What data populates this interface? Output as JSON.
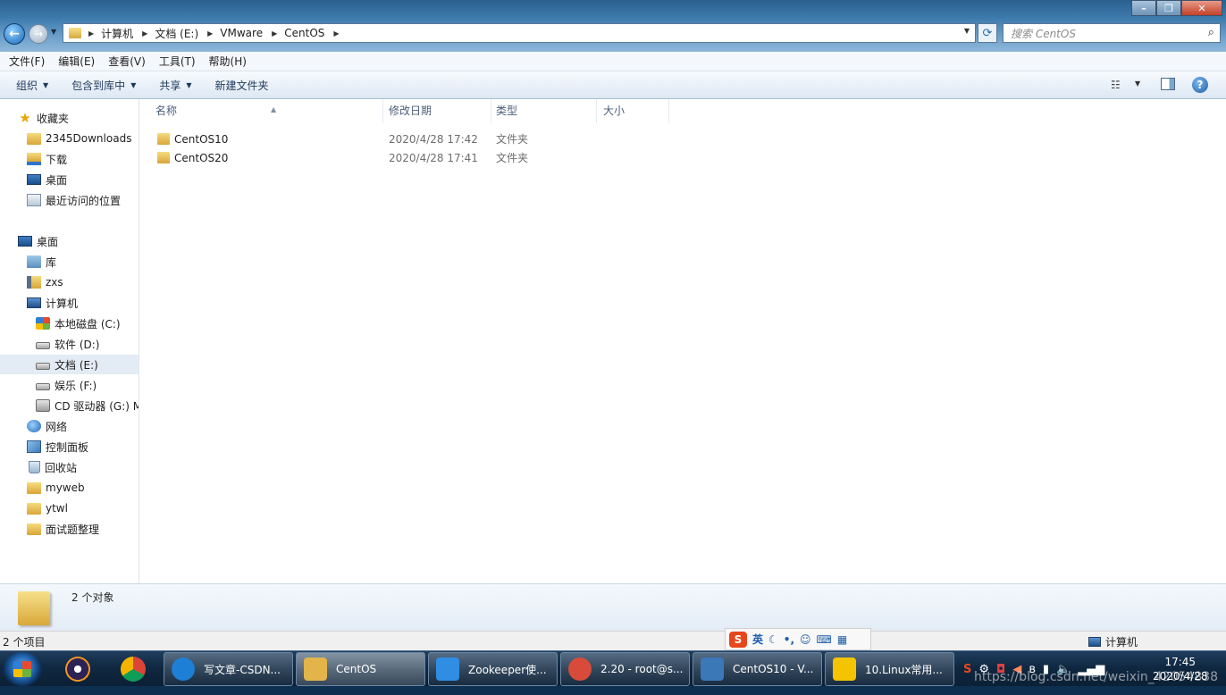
{
  "window": {
    "minimize": "–",
    "maximize": "❐",
    "close": "✕"
  },
  "nav": {
    "back": "←",
    "forward": "→"
  },
  "address": {
    "path": [
      "计算机",
      "文档 (E:)",
      "VMware",
      "CentOS"
    ]
  },
  "search": {
    "placeholder": "搜索 CentOS"
  },
  "menu": [
    "文件(F)",
    "编辑(E)",
    "查看(V)",
    "工具(T)",
    "帮助(H)"
  ],
  "toolbar": {
    "organize": "组织",
    "include_library": "包含到库中",
    "share": "共享",
    "new_folder": "新建文件夹"
  },
  "sidebar": {
    "favorites": {
      "label": "收藏夹",
      "items": [
        "2345Downloads",
        "下载",
        "桌面",
        "最近访问的位置"
      ]
    },
    "desktop": {
      "label": "桌面",
      "items": [
        "库",
        "zxs",
        "计算机"
      ],
      "drives": [
        "本地磁盘 (C:)",
        "软件 (D:)",
        "文档 (E:)",
        "娱乐 (F:)",
        "CD 驱动器 (G:) M"
      ],
      "more": [
        "网络",
        "控制面板",
        "回收站",
        "myweb",
        "ytwl",
        "面试题整理"
      ]
    }
  },
  "columns": [
    "名称",
    "修改日期",
    "类型",
    "大小"
  ],
  "files": [
    {
      "name": "CentOS10",
      "date": "2020/4/28 17:42",
      "type": "文件夹"
    },
    {
      "name": "CentOS20",
      "date": "2020/4/28 17:41",
      "type": "文件夹"
    }
  ],
  "details": {
    "summary": "2 个对象"
  },
  "status": {
    "count": "2 个项目",
    "location": "计算机"
  },
  "ime": {
    "lang": "英"
  },
  "taskbar": {
    "tasks": [
      {
        "label": "写文章-CSDN...",
        "color": "#1d7fd6"
      },
      {
        "label": "CentOS",
        "color": "#e2b44a"
      },
      {
        "label": "Zookeeper使...",
        "color": "#2f8de4"
      },
      {
        "label": "2.20 - root@s...",
        "color": "#d84a3a"
      },
      {
        "label": "CentOS10 - V...",
        "color": "#3a78b8"
      },
      {
        "label": "10.Linux常用...",
        "color": "#f5c400"
      }
    ],
    "clock_time": "17:45",
    "clock_date": "2020/4/28"
  },
  "watermark": "https://blog.csdn.net/weixin_42054838"
}
